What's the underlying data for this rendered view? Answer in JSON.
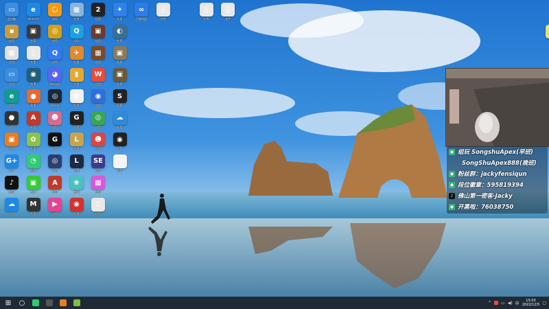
{
  "desktop_icons": [
    {
      "id": "this-pc",
      "label": "此电脑",
      "glyph": "▭",
      "color": "#3b8de0",
      "col": 0,
      "row": 0
    },
    {
      "id": "ie",
      "label": "Internet",
      "glyph": "e",
      "color": "#1e88e5",
      "col": 1,
      "row": 0
    },
    {
      "id": "app-c0r2",
      "label": "应用",
      "glyph": "⬡",
      "color": "#f39c12",
      "col": 2,
      "row": 0
    },
    {
      "id": "app-c0r3",
      "label": "应用",
      "glyph": "▦",
      "color": "#8ab4d8",
      "col": 3,
      "row": 0
    },
    {
      "id": "app-c0r4",
      "label": "应用",
      "glyph": "2",
      "color": "#222",
      "col": 4,
      "row": 0
    },
    {
      "id": "app-c0r5",
      "label": "应用",
      "glyph": "✦",
      "color": "#2f80ed",
      "col": 5,
      "row": 0
    },
    {
      "id": "baidu",
      "label": "百度网盘",
      "glyph": "∞",
      "color": "#2b7de9",
      "col": 6,
      "row": 0
    },
    {
      "id": "file1",
      "label": "文件",
      "glyph": "▯",
      "color": "#e8e8e8",
      "col": 7,
      "row": 0
    },
    {
      "id": "file2",
      "label": "文件",
      "glyph": "▯",
      "color": "#e8e8e8",
      "col": 9,
      "row": 0
    },
    {
      "id": "file3",
      "label": "文件",
      "glyph": "▯",
      "color": "#e8e8e8",
      "col": 10,
      "row": 0
    },
    {
      "id": "app-r1c0",
      "label": "应用",
      "glyph": "▪",
      "color": "#c89b3c",
      "col": 0,
      "row": 1
    },
    {
      "id": "app-r1c1",
      "label": "应用",
      "glyph": "▣",
      "color": "#3a3a3a",
      "col": 1,
      "row": 1
    },
    {
      "id": "app-r1c2",
      "label": "应用",
      "glyph": "◎",
      "color": "#d4a017",
      "col": 2,
      "row": 1
    },
    {
      "id": "qq",
      "label": "QQ",
      "glyph": "Q",
      "color": "#1ba1e2",
      "col": 3,
      "row": 1
    },
    {
      "id": "app-r1c4",
      "label": "应用",
      "glyph": "▣",
      "color": "#6b3b2b",
      "col": 4,
      "row": 1
    },
    {
      "id": "app-r1c5",
      "label": "应用",
      "glyph": "◐",
      "color": "#3c6e8f",
      "col": 5,
      "row": 1
    },
    {
      "id": "file-right",
      "label": "文件",
      "glyph": "▯",
      "color": "#e8e070",
      "col": 25,
      "row": 1
    },
    {
      "id": "app-r2c0",
      "label": "应用",
      "glyph": "▦",
      "color": "#e0e0e0",
      "col": 0,
      "row": 2
    },
    {
      "id": "app-r2c1",
      "label": "应用",
      "glyph": "▯",
      "color": "#e8e8e8",
      "col": 1,
      "row": 2
    },
    {
      "id": "app-r2c2",
      "label": "应用",
      "glyph": "Q",
      "color": "#3478f6",
      "col": 2,
      "row": 2
    },
    {
      "id": "csgo",
      "label": "应用",
      "glyph": "✈",
      "color": "#e08a2e",
      "col": 3,
      "row": 2
    },
    {
      "id": "app-r2c4",
      "label": "应用",
      "glyph": "▦",
      "color": "#7a4b2a",
      "col": 4,
      "row": 2
    },
    {
      "id": "app-r2c5",
      "label": "应用",
      "glyph": "▣",
      "color": "#8a7a5a",
      "col": 5,
      "row": 2
    },
    {
      "id": "app-r3c0",
      "label": "应用",
      "glyph": "▭",
      "color": "#3b8de0",
      "col": 0,
      "row": 3
    },
    {
      "id": "app-r3c1",
      "label": "应用",
      "glyph": "◉",
      "color": "#1f5f7a",
      "col": 1,
      "row": 3
    },
    {
      "id": "discord",
      "label": "Discord",
      "glyph": "◕",
      "color": "#5865f2",
      "col": 2,
      "row": 3
    },
    {
      "id": "app-r3c3",
      "label": "应用",
      "glyph": "▮",
      "color": "#e8a82e",
      "col": 3,
      "row": 3
    },
    {
      "id": "wps",
      "label": "应用",
      "glyph": "W",
      "color": "#e74c3c",
      "col": 4,
      "row": 3
    },
    {
      "id": "app-r3c5",
      "label": "应用",
      "glyph": "▣",
      "color": "#6a5a3a",
      "col": 5,
      "row": 3
    },
    {
      "id": "edge",
      "label": "应用",
      "glyph": "e",
      "color": "#0f9d8f",
      "col": 0,
      "row": 4
    },
    {
      "id": "app-r4c1",
      "label": "应用",
      "glyph": "●",
      "color": "#e86a2e",
      "col": 1,
      "row": 4
    },
    {
      "id": "steam",
      "label": "Steam",
      "glyph": "◎",
      "color": "#1b2838",
      "col": 2,
      "row": 4
    },
    {
      "id": "app-r4c3",
      "label": "应用",
      "glyph": "✿",
      "color": "#f0f0f0",
      "col": 3,
      "row": 4
    },
    {
      "id": "app-r4c4",
      "label": "应用",
      "glyph": "◉",
      "color": "#2e6fd8",
      "col": 4,
      "row": 4
    },
    {
      "id": "app-r4c5",
      "label": "应用",
      "glyph": "S",
      "color": "#222",
      "col": 5,
      "row": 4
    },
    {
      "id": "app-r5c0",
      "label": "应用",
      "glyph": "●",
      "color": "#333",
      "col": 0,
      "row": 5
    },
    {
      "id": "apex",
      "label": "应用",
      "glyph": "A",
      "color": "#c0392b",
      "col": 1,
      "row": 5
    },
    {
      "id": "app-r5c2",
      "label": "应用",
      "glyph": "☻",
      "color": "#d86a8a",
      "col": 2,
      "row": 5
    },
    {
      "id": "app-r5c3",
      "label": "应用",
      "glyph": "G",
      "color": "#222",
      "col": 3,
      "row": 5
    },
    {
      "id": "app-r5c4",
      "label": "应用",
      "glyph": "◎",
      "color": "#3aa655",
      "col": 4,
      "row": 5
    },
    {
      "id": "app-r5c5",
      "label": "应用",
      "glyph": "☁",
      "color": "#2e8bd8",
      "col": 5,
      "row": 5
    },
    {
      "id": "app-r6c0",
      "label": "应用",
      "glyph": "▣",
      "color": "#f07a1a",
      "col": 0,
      "row": 6
    },
    {
      "id": "app-r6c1",
      "label": "应用",
      "glyph": "✿",
      "color": "#8bc34a",
      "col": 1,
      "row": 6
    },
    {
      "id": "app-r6c2",
      "label": "应用",
      "glyph": "G",
      "color": "#111",
      "col": 2,
      "row": 6
    },
    {
      "id": "lol",
      "label": "应用",
      "glyph": "L",
      "color": "#c8a44a",
      "col": 3,
      "row": 6
    },
    {
      "id": "app-r6c4",
      "label": "应用",
      "glyph": "☻",
      "color": "#d44",
      "col": 4,
      "row": 6
    },
    {
      "id": "app-r6c5",
      "label": "应用",
      "glyph": "◉",
      "color": "#222",
      "col": 5,
      "row": 6
    },
    {
      "id": "app-r7c0",
      "label": "应用",
      "glyph": "G+",
      "color": "#1e88e5",
      "col": 0,
      "row": 7
    },
    {
      "id": "wechat",
      "label": "应用",
      "glyph": "◔",
      "color": "#2ecc71",
      "col": 1,
      "row": 7
    },
    {
      "id": "app-r7c2",
      "label": "应用",
      "glyph": "◎",
      "color": "#2a3f6e",
      "col": 2,
      "row": 7
    },
    {
      "id": "app-r7c3",
      "label": "应用",
      "glyph": "L",
      "color": "#1d2a44",
      "col": 3,
      "row": 7
    },
    {
      "id": "app-r7c4",
      "label": "应用",
      "glyph": "SE",
      "color": "#3b3b8a",
      "col": 4,
      "row": 7
    },
    {
      "id": "app-r7c5",
      "label": "应用",
      "glyph": "↖",
      "color": "#f5f5f5",
      "col": 5,
      "row": 7
    },
    {
      "id": "tiktok",
      "label": "应用",
      "glyph": "♪",
      "color": "#111",
      "col": 0,
      "row": 8
    },
    {
      "id": "app-r8c1",
      "label": "应用",
      "glyph": "▣",
      "color": "#3c3",
      "col": 1,
      "row": 8
    },
    {
      "id": "apex2",
      "label": "应用",
      "glyph": "A",
      "color": "#c0392b",
      "col": 2,
      "row": 8
    },
    {
      "id": "app-r8c3",
      "label": "应用",
      "glyph": "❀",
      "color": "#4bc0c0",
      "col": 3,
      "row": 8
    },
    {
      "id": "app-r8c4",
      "label": "应用",
      "glyph": "▦",
      "color": "#d85ad8",
      "col": 4,
      "row": 8
    },
    {
      "id": "app-r9c0",
      "label": "应用",
      "glyph": "☁",
      "color": "#1e88e5",
      "col": 0,
      "row": 9
    },
    {
      "id": "app-r9c1",
      "label": "应用",
      "glyph": "M",
      "color": "#333",
      "col": 1,
      "row": 9
    },
    {
      "id": "app-r9c2",
      "label": "应用",
      "glyph": "▶",
      "color": "#e84393",
      "col": 2,
      "row": 9
    },
    {
      "id": "netease",
      "label": "应用",
      "glyph": "◉",
      "color": "#d63031",
      "col": 3,
      "row": 9
    },
    {
      "id": "app-r9c4",
      "label": "应用",
      "glyph": "▯",
      "color": "#e8e8e8",
      "col": 4,
      "row": 9
    }
  ],
  "overlay": {
    "lines": [
      {
        "icon": "wechat",
        "text": "组玩 SongshuApex(早班)",
        "color": "#2ecc71"
      },
      {
        "icon": "none",
        "text": "SongShuApex888(晚班)",
        "color": "transparent"
      },
      {
        "icon": "wechat",
        "text": "粉丝群：jackyfensiqun",
        "color": "#2ecc71"
      },
      {
        "icon": "wechat",
        "text": "段位徽章：595819394",
        "color": "#2ecc71"
      },
      {
        "icon": "tiktok",
        "text": "佛山第一密客-Jacky",
        "color": "#111"
      },
      {
        "icon": "msg",
        "text": "开黑啦：76038750",
        "color": "#2ecc71"
      }
    ]
  },
  "taskbar": {
    "start_glyph": "⊞",
    "search_glyph": "○",
    "apps": [
      {
        "id": "wechat-task",
        "glyph": "◔",
        "color": "#2ecc71"
      },
      {
        "id": "app-task-2",
        "glyph": "●",
        "color": "#555"
      },
      {
        "id": "app-task-3",
        "glyph": "▣",
        "color": "#e67e22"
      },
      {
        "id": "app-task-4",
        "glyph": "▣",
        "color": "#7bc043"
      }
    ],
    "clock_time": "15:03",
    "clock_date": "2022/12/5"
  }
}
